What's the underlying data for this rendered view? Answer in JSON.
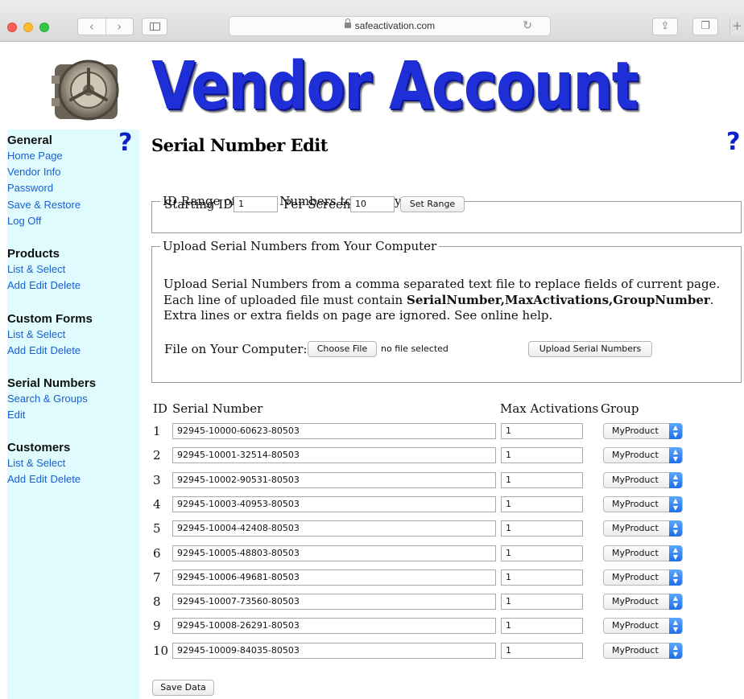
{
  "browser": {
    "url": "safeactivation.com"
  },
  "header": {
    "banner": "Vendor Account"
  },
  "sidebar": {
    "help": "?",
    "sections": [
      {
        "heading": "General",
        "links": [
          "Home Page",
          "Vendor Info",
          "Password",
          "Save & Restore",
          "Log Off"
        ]
      },
      {
        "heading": "Products",
        "links": [
          "List & Select"
        ],
        "actions": [
          "Add",
          "Edit",
          "Delete"
        ]
      },
      {
        "heading": "Custom Forms",
        "links": [
          "List & Select"
        ],
        "actions": [
          "Add",
          "Edit",
          "Delete"
        ]
      },
      {
        "heading": "Serial Numbers",
        "links": [
          "Search & Groups",
          "Edit"
        ]
      },
      {
        "heading": "Customers",
        "links": [
          "List & Select"
        ],
        "actions": [
          "Add",
          "Edit",
          "Delete"
        ]
      }
    ]
  },
  "main": {
    "title": "Serial Number Edit",
    "help": "?",
    "range": {
      "legend": "ID Range of Serial Numbers to Display",
      "starting_label": "Starting ID",
      "starting_value": "1",
      "per_screen_label": "Per Screen",
      "per_screen_value": "10",
      "button": "Set Range"
    },
    "upload": {
      "legend": "Upload Serial Numbers from Your Computer",
      "text_1": "Upload Serial Numbers from a comma separated text file to replace fields of current page. Each line of uploaded file must contain ",
      "text_bold": "SerialNumber,MaxActivations,GroupNumber",
      "text_2": ". Extra lines or extra fields on page are ignored. See online help.",
      "file_label": "File on Your Computer:",
      "choose_button": "Choose File",
      "no_file": "no file selected",
      "upload_button": "Upload Serial Numbers"
    },
    "table": {
      "headers": {
        "id": "ID",
        "serial": "Serial Number",
        "max": "Max Activations",
        "group": "Group"
      },
      "rows": [
        {
          "id": "1",
          "serial": "92945-10000-60623-80503",
          "max": "1",
          "group": "MyProduct"
        },
        {
          "id": "2",
          "serial": "92945-10001-32514-80503",
          "max": "1",
          "group": "MyProduct"
        },
        {
          "id": "3",
          "serial": "92945-10002-90531-80503",
          "max": "1",
          "group": "MyProduct"
        },
        {
          "id": "4",
          "serial": "92945-10003-40953-80503",
          "max": "1",
          "group": "MyProduct"
        },
        {
          "id": "5",
          "serial": "92945-10004-42408-80503",
          "max": "1",
          "group": "MyProduct"
        },
        {
          "id": "6",
          "serial": "92945-10005-48803-80503",
          "max": "1",
          "group": "MyProduct"
        },
        {
          "id": "7",
          "serial": "92945-10006-49681-80503",
          "max": "1",
          "group": "MyProduct"
        },
        {
          "id": "8",
          "serial": "92945-10007-73560-80503",
          "max": "1",
          "group": "MyProduct"
        },
        {
          "id": "9",
          "serial": "92945-10008-26291-80503",
          "max": "1",
          "group": "MyProduct"
        },
        {
          "id": "10",
          "serial": "92945-10009-84035-80503",
          "max": "1",
          "group": "MyProduct"
        }
      ]
    },
    "save_button": "Save Data"
  },
  "colors": {
    "banner": "#1e2fd8",
    "sidebar_bg": "#dffbfd",
    "link": "#1a5fd0",
    "help_icon": "#0d1fc8"
  }
}
